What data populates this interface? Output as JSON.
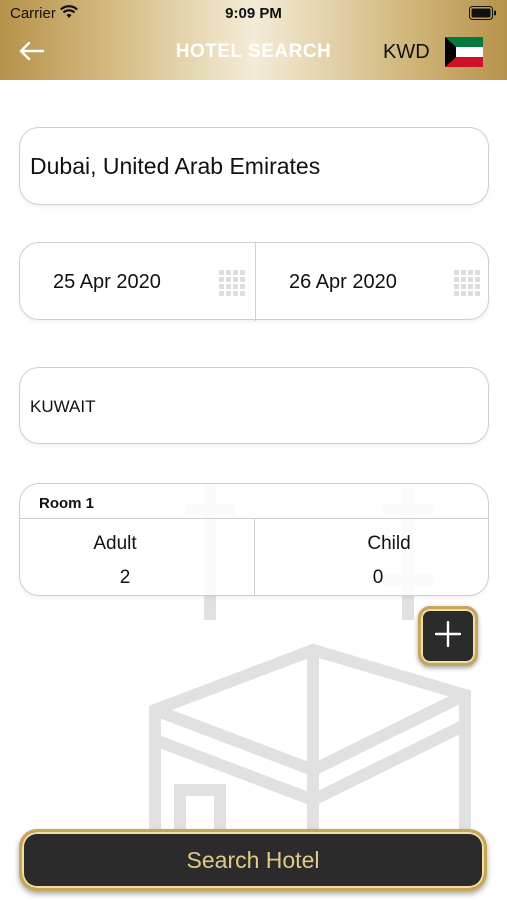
{
  "status_bar": {
    "carrier": "Carrier",
    "time": "9:09 PM"
  },
  "nav": {
    "title": "HOTEL SEARCH",
    "currency": "KWD",
    "back_icon": "arrow-left-icon",
    "flag_icon": "kuwait-flag-icon"
  },
  "search": {
    "destination": "Dubai, United Arab Emirates",
    "check_in": "25 Apr  2020",
    "check_out": "26 Apr  2020",
    "calendar_icon": "calendar-icon",
    "nationality": "KUWAIT"
  },
  "room": {
    "title": "Room 1",
    "adult_label": "Adult",
    "adult_count": "2",
    "child_label": "Child",
    "child_count": "0"
  },
  "actions": {
    "add_room_icon": "plus-icon",
    "search_label": "Search Hotel"
  },
  "colors": {
    "header_gold": "#b7924a",
    "button_dark": "#2b2b2b",
    "button_gold_text": "#e3c989",
    "border_gold": "#c9a55a"
  }
}
